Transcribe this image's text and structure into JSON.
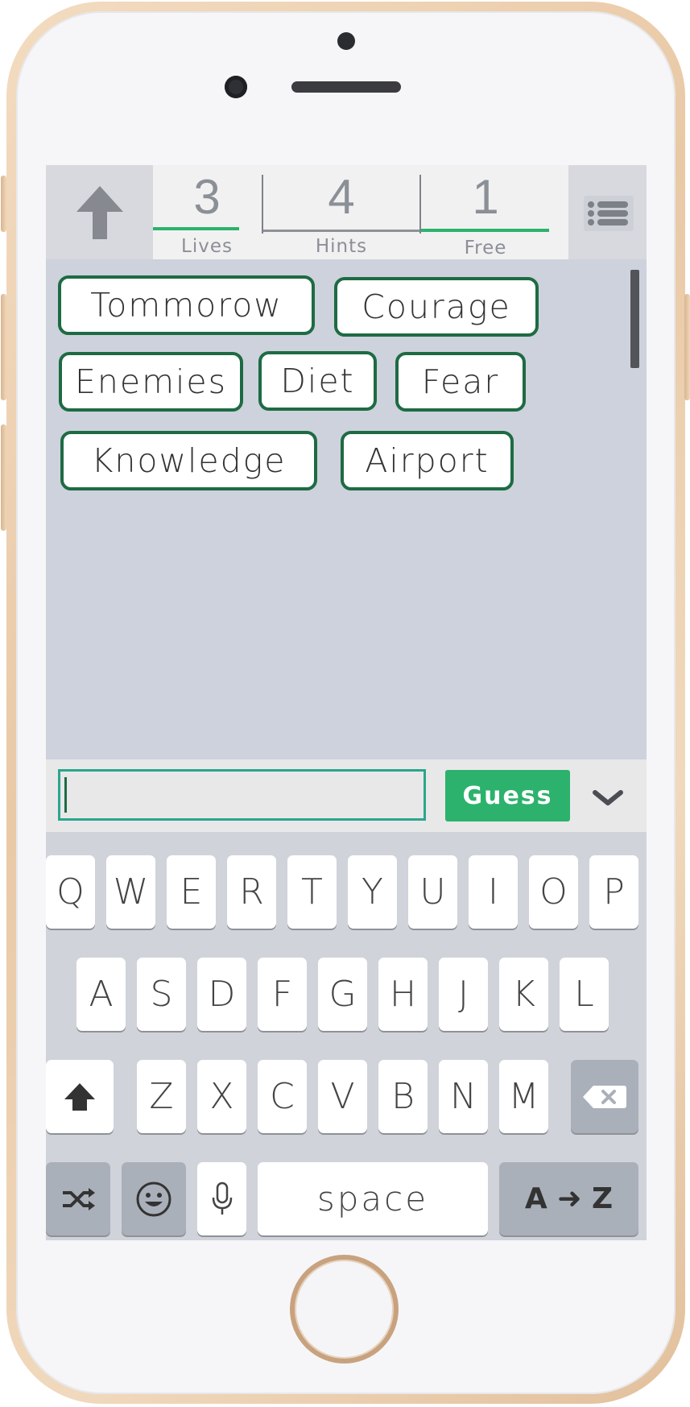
{
  "stats": {
    "lives": {
      "value": "3",
      "label": "Lives"
    },
    "hints": {
      "value": "4",
      "label": "Hints"
    },
    "free": {
      "value": "1",
      "label": "Free"
    }
  },
  "words": [
    "Tommorow",
    "Courage",
    "Enemies",
    "Diet",
    "Fear",
    "Knowledge",
    "Airport"
  ],
  "guess": {
    "input_value": "",
    "button_label": "Guess"
  },
  "keyboard": {
    "row1": [
      "Q",
      "W",
      "E",
      "R",
      "T",
      "Y",
      "U",
      "I",
      "O",
      "P"
    ],
    "row2": [
      "A",
      "S",
      "D",
      "F",
      "G",
      "H",
      "J",
      "K",
      "L"
    ],
    "row3": [
      "Z",
      "X",
      "C",
      "V",
      "B",
      "N",
      "M"
    ],
    "space_label": "space",
    "sort_label": "A ➜ Z"
  },
  "icons": [
    "up-arrow-icon",
    "menu-list-icon",
    "chevron-down-icon",
    "shift-icon",
    "backspace-icon",
    "shuffle-icon",
    "emoji-icon",
    "microphone-icon"
  ],
  "colors": {
    "accent_green": "#2cb26d",
    "word_border": "#1e6b43",
    "input_border": "#2aa68c",
    "screen_bg": "#cdd2dc"
  }
}
